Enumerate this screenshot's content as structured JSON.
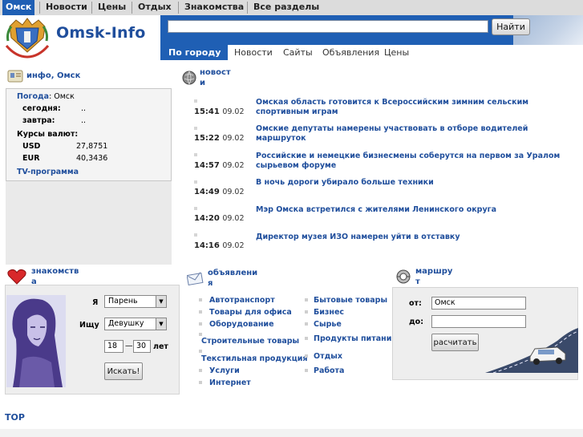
{
  "topnav": {
    "items": [
      "Омск",
      "Новости",
      "Цены",
      "Отдых",
      "Знакомства",
      "Все разделы"
    ]
  },
  "header": {
    "logo_text": "Omsk-Info",
    "search_placeholder": "",
    "search_value": "",
    "search_button": "Найти"
  },
  "subnav": {
    "items": [
      "По городу",
      "Новости",
      "Сайты",
      "Объявления",
      "Цены"
    ]
  },
  "info": {
    "title": "инфо, Омск",
    "weather_label": "Погода",
    "weather_city": ": Омск",
    "today_label": "сегодня:",
    "today_value": "..",
    "tomorrow_label": "завтра:",
    "tomorrow_value": "..",
    "rates_label": "Курсы валют:",
    "usd_label": "USD",
    "usd_value": "27,8751",
    "eur_label": "EUR",
    "eur_value": "40,3436",
    "tv_link": "TV-программа"
  },
  "news": {
    "title_1": "новост",
    "title_2": "и",
    "items": [
      {
        "time": "15:41",
        "date": "09.02",
        "text": "Омская область готовится к Всероссийским зимним сельским спортивным играм"
      },
      {
        "time": "15:22",
        "date": "09.02",
        "text": "Омские депутаты намерены участвовать в отборе водителей маршруток"
      },
      {
        "time": "14:57",
        "date": "09.02",
        "text": "Российские и немецкие бизнесмены соберутся на первом за Уралом сырьевом форуме"
      },
      {
        "time": "14:49",
        "date": "09.02",
        "text": "В ночь дороги убирало больше техники"
      },
      {
        "time": "14:20",
        "date": "09.02",
        "text": "Мэр Омска встретился с жителями Ленинского округа"
      },
      {
        "time": "14:16",
        "date": "09.02",
        "text": "Директор музея ИЗО намерен уйти в отставку"
      }
    ]
  },
  "dating": {
    "title_1": "знакомств",
    "title_2": "а",
    "i_label": "Я",
    "i_value": "Парень",
    "seek_label": "Ищу",
    "seek_value": "Девушку",
    "age_from": "18",
    "dash": "—",
    "age_to": "30",
    "age_unit": "лет",
    "search_button": "Искать!"
  },
  "ads": {
    "title_1": "объявлени",
    "title_2": "я",
    "col1": [
      "Автотранспорт",
      "Товары для офиса",
      "Оборудование",
      "Строительные товары",
      "Текстильная продукция",
      "Услуги",
      "Интернет"
    ],
    "col2": [
      "Бытовые товары",
      "Бизнес",
      "Сырье",
      "Продукты питания",
      "Отдых",
      "Работа"
    ]
  },
  "route": {
    "title_1": "маршру",
    "title_2": "т",
    "from_label": "от:",
    "from_value": "Омск",
    "to_label": "до:",
    "to_value": "",
    "calc_button": "расчитать"
  },
  "footer": {
    "top_link": "TOP"
  }
}
